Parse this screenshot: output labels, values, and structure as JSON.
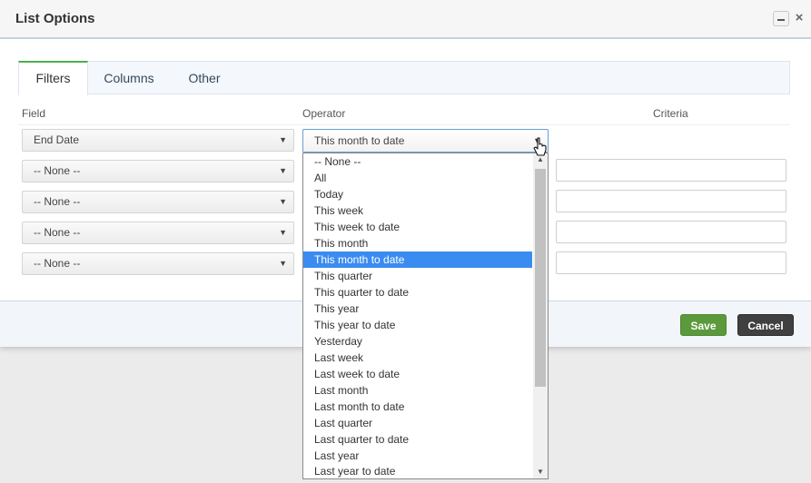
{
  "dialog": {
    "title": "List Options",
    "minimize_icon": "minimize-icon",
    "close_label": "×"
  },
  "tabs": [
    {
      "label": "Filters",
      "active": true
    },
    {
      "label": "Columns",
      "active": false
    },
    {
      "label": "Other",
      "active": false
    }
  ],
  "columns": {
    "field": "Field",
    "operator": "Operator",
    "criteria": "Criteria"
  },
  "rows": [
    {
      "field": "End Date",
      "operator": "This month to date",
      "criteria": ""
    },
    {
      "field": "-- None --",
      "criteria": ""
    },
    {
      "field": "-- None --",
      "criteria": ""
    },
    {
      "field": "-- None --",
      "criteria": ""
    },
    {
      "field": "-- None --",
      "criteria": ""
    }
  ],
  "operator_dropdown": {
    "selected": "This month to date",
    "options": [
      "-- None --",
      "All",
      "Today",
      "This week",
      "This week to date",
      "This month",
      "This month to date",
      "This quarter",
      "This quarter to date",
      "This year",
      "This year to date",
      "Yesterday",
      "Last week",
      "Last week to date",
      "Last month",
      "Last month to date",
      "Last quarter",
      "Last quarter to date",
      "Last year",
      "Last year to date"
    ]
  },
  "footer": {
    "save_label": "Save",
    "cancel_label": "Cancel"
  },
  "colors": {
    "accent_tab": "#4caf50",
    "save_button": "#5b9a3c",
    "cancel_button": "#404040",
    "dropdown_highlight": "#3b8cf0"
  },
  "arrow_glyph": "▼",
  "scroll_up_glyph": "▲",
  "scroll_down_glyph": "▼"
}
